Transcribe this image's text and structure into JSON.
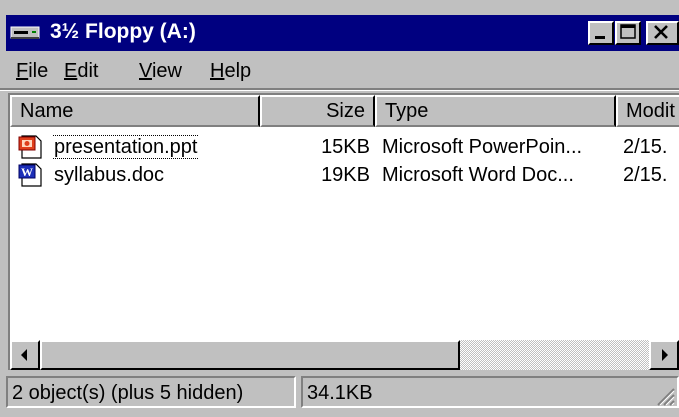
{
  "window": {
    "title": "3½ Floppy (A:)",
    "title_icon": "floppy-drive-icon",
    "title_bar_color": "#000080"
  },
  "menu": {
    "items": [
      {
        "label": "File",
        "accel": "F",
        "rest": "ile"
      },
      {
        "label": "Edit",
        "accel": "E",
        "rest": "dit"
      },
      {
        "label": "View",
        "accel": "V",
        "rest": "iew"
      },
      {
        "label": "Help",
        "accel": "H",
        "rest": "elp"
      }
    ]
  },
  "list": {
    "columns": [
      "Name",
      "Size",
      "Type",
      "Modit"
    ],
    "rows": [
      {
        "name": "presentation.ppt",
        "size": "15KB",
        "type": "Microsoft PowerPoin...",
        "modified": "2/15.",
        "icon": "powerpoint-file-icon",
        "focused": true
      },
      {
        "name": "syllabus.doc",
        "size": "19KB",
        "type": "Microsoft Word Doc...",
        "modified": "2/15.",
        "icon": "word-document-icon",
        "focused": false
      }
    ]
  },
  "status": {
    "objects": "2 object(s) (plus 5 hidden)",
    "size": "34.1KB"
  }
}
